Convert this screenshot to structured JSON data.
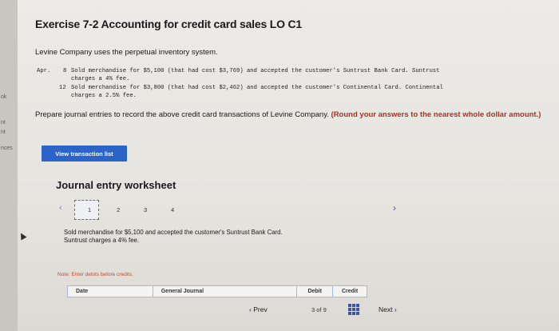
{
  "sidebar": {
    "labels": [
      "ok",
      "nt",
      "nt",
      "nces"
    ]
  },
  "exercise": {
    "title": "Exercise 7-2 Accounting for credit card sales LO C1",
    "intro": "Levine Company uses the perpetual inventory system."
  },
  "transactions": {
    "month": "Apr.",
    "items": [
      {
        "day": "8",
        "line1": "Sold merchandise for $5,100 (that had cost $3,769) and accepted the customer's Suntrust Bank Card. Suntrust",
        "line2": "charges a 4% fee."
      },
      {
        "day": "12",
        "line1": "Sold merchandise for $3,800 (that had cost $2,462) and accepted the customer's Continental Card. Continental",
        "line2": "charges a 2.5% fee."
      }
    ]
  },
  "prompt": {
    "text": "Prepare journal entries to record the above credit card transactions of Levine Company. ",
    "emphasis": "(Round your answers to the nearest whole dollar amount.)"
  },
  "buttons": {
    "view_transaction_list": "View transaction list"
  },
  "worksheet": {
    "title": "Journal entry worksheet",
    "prev_arrow": "‹",
    "next_arrow": "›",
    "steps": [
      "1",
      "2",
      "3",
      "4"
    ],
    "active_step": "1",
    "description_line1": "Sold merchandise for $5,100 and accepted the customer's Suntrust Bank Card.",
    "description_line2": "Suntrust charges a 4% fee.",
    "note": "Note: Enter debits before credits.",
    "columns": [
      "Date",
      "General Journal",
      "Debit",
      "Credit"
    ]
  },
  "pagination": {
    "prev_label": "Prev",
    "page_text": "3 of 9",
    "next_label": "Next",
    "prev_arrow": "‹",
    "next_arrow": "›"
  }
}
